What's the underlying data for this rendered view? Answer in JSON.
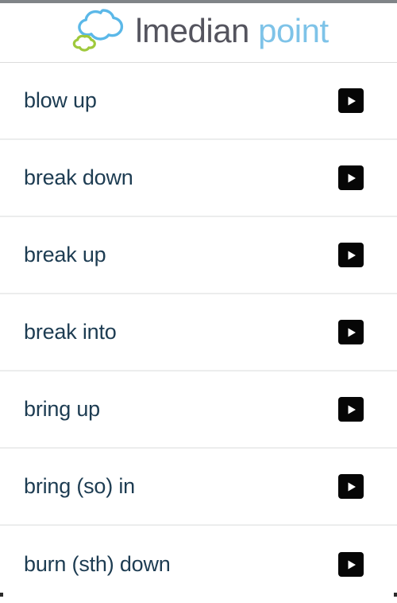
{
  "header": {
    "logo_icon": "double-cloud-logo",
    "cloud_large_color": "#5bb8e8",
    "cloud_small_color": "#9fc93c",
    "title_primary": "lmedian",
    "title_secondary": "point",
    "title_primary_color": "#54545e",
    "title_secondary_color": "#7ec3e8"
  },
  "list": {
    "row_text_color": "#1d3c52",
    "divider_color": "#eceded",
    "play_button_color": "#060606",
    "items": [
      {
        "label": "blow up",
        "action_icon": "play-icon"
      },
      {
        "label": "break down",
        "action_icon": "play-icon"
      },
      {
        "label": "break up",
        "action_icon": "play-icon"
      },
      {
        "label": "break into",
        "action_icon": "play-icon"
      },
      {
        "label": "bring up",
        "action_icon": "play-icon"
      },
      {
        "label": "bring (so) in",
        "action_icon": "play-icon"
      },
      {
        "label": "burn (sth) down",
        "action_icon": "play-icon"
      }
    ]
  },
  "chrome": {
    "topbar_color": "#808488"
  }
}
